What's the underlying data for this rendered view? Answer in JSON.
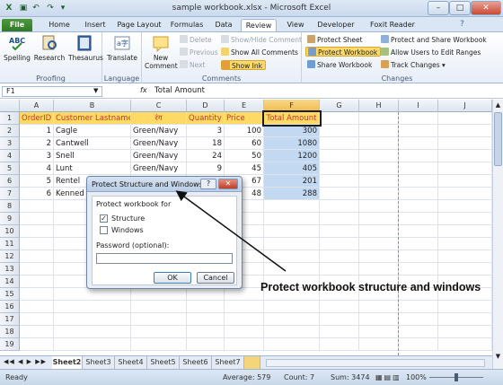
{
  "window": {
    "title": "sample workbook.xlsx  -  Microsoft Excel",
    "min": "–",
    "max": "□",
    "close": "✕"
  },
  "tabs": [
    "File",
    "Home",
    "Insert",
    "Page Layout",
    "Formulas",
    "Data",
    "Review",
    "View",
    "Developer",
    "Foxit Reader PDF"
  ],
  "ribbon": {
    "proofing": {
      "label": "Proofing",
      "spelling": "Spelling",
      "research": "Research",
      "thesaurus": "Thesaurus"
    },
    "language": {
      "label": "Language",
      "translate": "Translate"
    },
    "comments": {
      "label": "Comments",
      "new": "New Comment",
      "delete": "Delete",
      "previous": "Previous",
      "next": "Next",
      "show_hide": "Show/Hide Comment",
      "show_all": "Show All Comments",
      "show_ink": "Show Ink"
    },
    "changes": {
      "label": "Changes",
      "protect_sheet": "Protect Sheet",
      "protect_workbook": "Protect Workbook",
      "share_workbook": "Share Workbook",
      "protect_share": "Protect and Share Workbook",
      "allow_users": "Allow Users to Edit Ranges",
      "track_changes": "Track Changes ▾"
    }
  },
  "formula_bar": {
    "name_box": "F1",
    "fx": "fx",
    "content": "Total Amount"
  },
  "columns": [
    "A",
    "B",
    "C",
    "D",
    "E",
    "F",
    "G",
    "H",
    "I",
    "J"
  ],
  "rows": [
    "1",
    "2",
    "3",
    "4",
    "5",
    "6",
    "7",
    "8",
    "9",
    "10",
    "11",
    "12",
    "13",
    "14",
    "15",
    "16",
    "17",
    "18",
    "19"
  ],
  "table": {
    "headers": [
      "OrderID",
      "Customer Lastname",
      "रंग",
      "Quantity",
      "Price",
      "Total Amount"
    ],
    "data": [
      [
        "1",
        "Cagle",
        "Green/Navy",
        "3",
        "100",
        "300"
      ],
      [
        "2",
        "Cantwell",
        "Green/Navy",
        "18",
        "60",
        "1080"
      ],
      [
        "3",
        "Snell",
        "Green/Navy",
        "24",
        "50",
        "1200"
      ],
      [
        "4",
        "Lunt",
        "Green/Navy",
        "9",
        "45",
        "405"
      ],
      [
        "5",
        "Rentel",
        "",
        "",
        "67",
        "201"
      ],
      [
        "6",
        "Kenned",
        "",
        "",
        "48",
        "288"
      ]
    ]
  },
  "sheets": [
    "Sheet2",
    "Sheet3",
    "Sheet4",
    "Sheet5",
    "Sheet6",
    "Sheet7"
  ],
  "status": {
    "ready": "Ready",
    "average": "Average: 579",
    "count": "Count: 7",
    "sum": "Sum: 3474",
    "zoom": "100%"
  },
  "dialog": {
    "title": "Protect Structure and Windows",
    "help": "?",
    "section": "Protect workbook for",
    "structure": "Structure",
    "windows": "Windows",
    "password_label": "Password (optional):",
    "ok": "OK",
    "cancel": "Cancel",
    "structure_checked": true,
    "windows_checked": false
  },
  "callout": "Protect workbook structure and windows"
}
